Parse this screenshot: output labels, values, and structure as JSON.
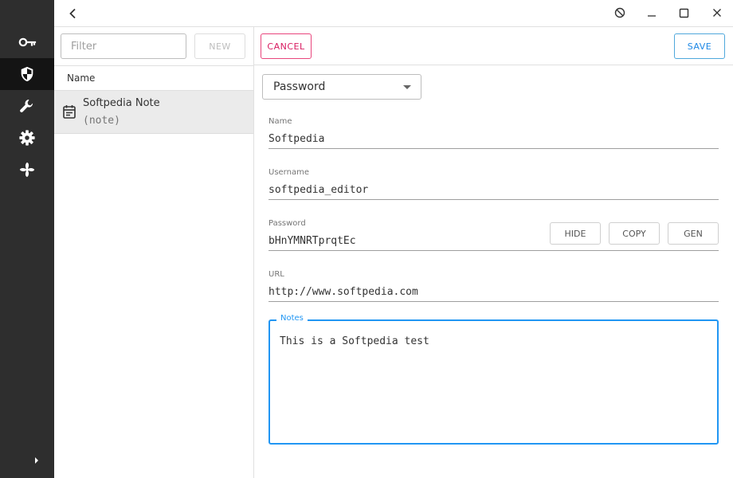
{
  "rail": {
    "items": [
      {
        "icon": "key-icon",
        "active": false
      },
      {
        "icon": "shield-icon",
        "active": true
      },
      {
        "icon": "wrench-icon",
        "active": false
      },
      {
        "icon": "gear-icon",
        "active": false
      },
      {
        "icon": "pinwheel-icon",
        "active": false
      }
    ],
    "expand_icon": "chevron-right-icon"
  },
  "titlebar": {
    "back_icon": "chevron-left-icon",
    "buttons": [
      "block-icon",
      "minimize-icon",
      "maximize-icon",
      "close-icon"
    ]
  },
  "list": {
    "filter_placeholder": "Filter",
    "new_label": "NEW",
    "column_header": "Name",
    "items": [
      {
        "title": "Softpedia Note",
        "subtitle": "(note)",
        "icon": "note-icon"
      }
    ]
  },
  "editor": {
    "cancel_label": "CANCEL",
    "save_label": "SAVE",
    "type_selected": "Password",
    "fields": {
      "name": {
        "label": "Name",
        "value": "Softpedia"
      },
      "username": {
        "label": "Username",
        "value": "softpedia_editor"
      },
      "password": {
        "label": "Password",
        "value": "bHnYMNRTprqtEc"
      },
      "url": {
        "label": "URL",
        "value": "http://www.softpedia.com"
      }
    },
    "password_buttons": {
      "hide": "HIDE",
      "copy": "COPY",
      "gen": "GEN"
    },
    "notes": {
      "label": "Notes",
      "value": "This is a Softpedia test"
    }
  },
  "colors": {
    "rail_bg": "#2e2e2e",
    "rail_active": "#141414",
    "cancel": "#d81b60",
    "save": "#1e88e5",
    "focus": "#2196f3"
  }
}
